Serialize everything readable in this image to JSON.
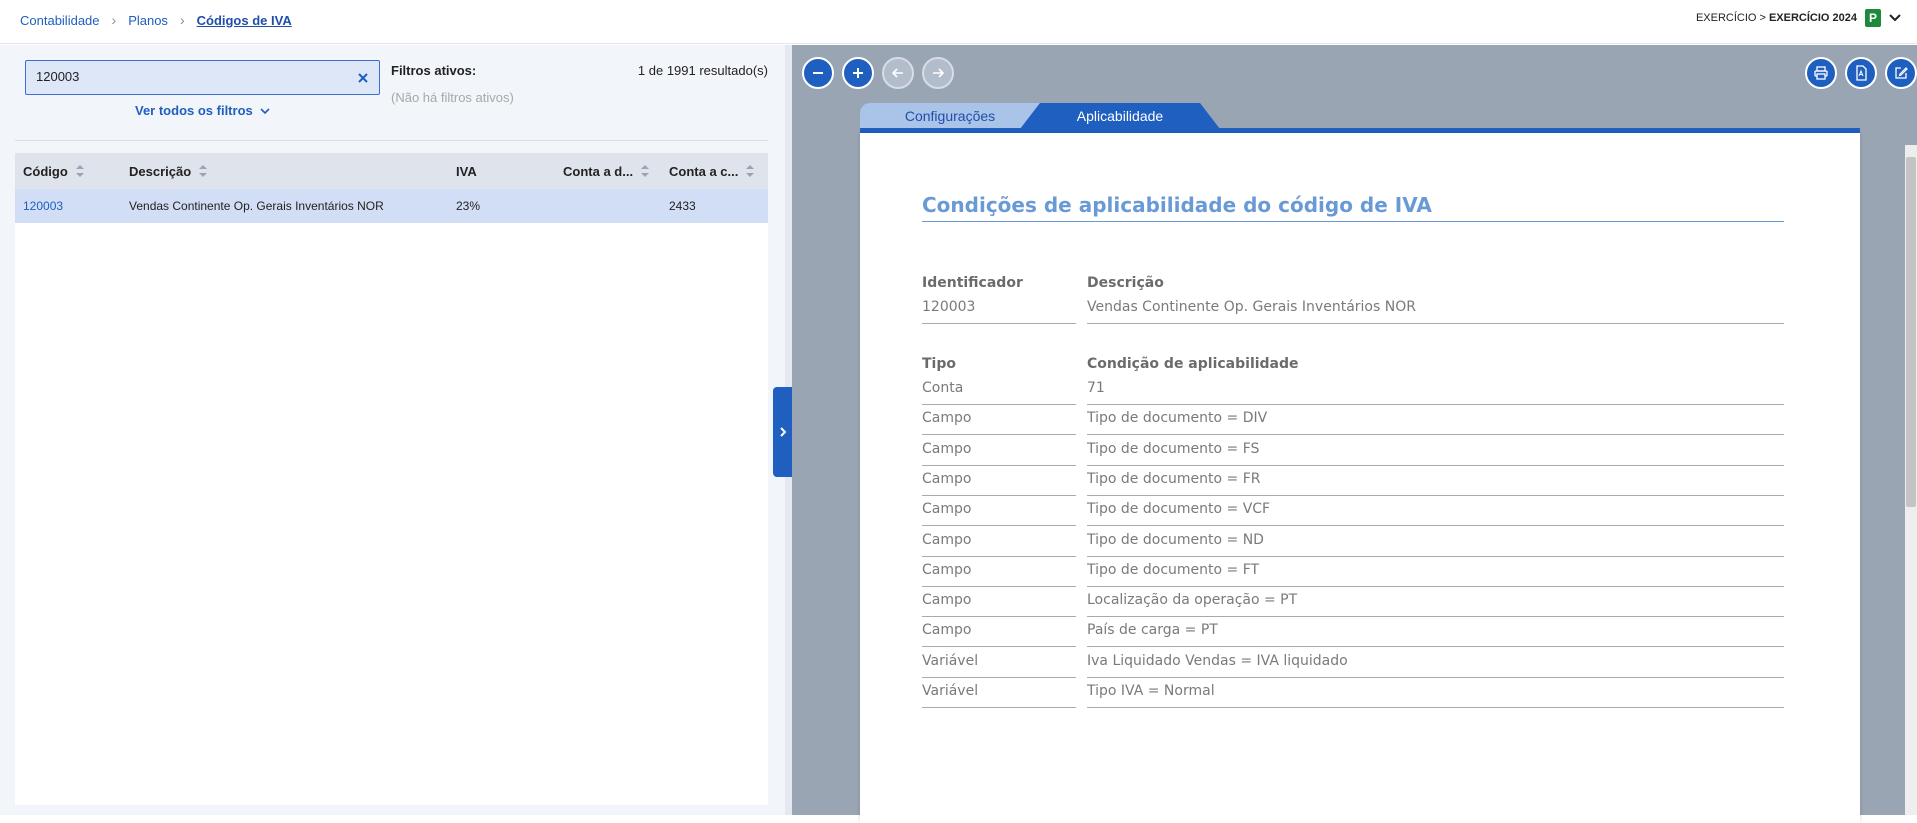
{
  "breadcrumb": [
    "Contabilidade",
    "Planos",
    "Códigos de IVA"
  ],
  "exercise": {
    "label": "EXERCÍCIO >",
    "value": "EXERCÍCIO 2024",
    "badge": "P"
  },
  "search": {
    "value": "120003",
    "placeholder": ""
  },
  "filters": {
    "link": "Ver todos os filtros",
    "active_title": "Filtros ativos:",
    "none": "(Não há filtros ativos)"
  },
  "results": "1 de 1991 resultado(s)",
  "table": {
    "columns": [
      "Código",
      "Descrição",
      "IVA",
      "Conta a d...",
      "Conta a c..."
    ],
    "rows": [
      {
        "codigo": "120003",
        "descricao": "Vendas Continente Op. Gerais Inventários NOR",
        "iva": "23%",
        "conta_d": "",
        "conta_c": "2433"
      }
    ]
  },
  "viewer": {
    "tabs": [
      "Configurações",
      "Aplicabilidade"
    ],
    "active_tab": "Aplicabilidade",
    "title": "Condições de aplicabilidade do código de IVA",
    "header1": {
      "identificador": "Identificador",
      "descricao": "Descrição"
    },
    "record": {
      "identificador": "120003",
      "descricao": "Vendas Continente Op. Gerais Inventários NOR"
    },
    "header2": {
      "tipo": "Tipo",
      "condicao": "Condição de aplicabilidade"
    },
    "conditions": [
      {
        "tipo": "Conta",
        "condicao": "71"
      },
      {
        "tipo": "Campo",
        "condicao": "Tipo de documento = DIV"
      },
      {
        "tipo": "Campo",
        "condicao": "Tipo de documento = FS"
      },
      {
        "tipo": "Campo",
        "condicao": "Tipo de documento = FR"
      },
      {
        "tipo": "Campo",
        "condicao": "Tipo de documento = VCF"
      },
      {
        "tipo": "Campo",
        "condicao": "Tipo de documento = ND"
      },
      {
        "tipo": "Campo",
        "condicao": "Tipo de documento = FT"
      },
      {
        "tipo": "Campo",
        "condicao": "Localização da operação = PT"
      },
      {
        "tipo": "Campo",
        "condicao": "País de carga = PT"
      },
      {
        "tipo": "Variável",
        "condicao": "Iva Liquidado Vendas = IVA liquidado"
      },
      {
        "tipo": "Variável",
        "condicao": "Tipo IVA = Normal"
      }
    ]
  },
  "colors": {
    "accent": "#1f5fbf",
    "title": "#6a9ad6",
    "selected_row": "#d2def5",
    "badge": "#1c8a3a"
  }
}
